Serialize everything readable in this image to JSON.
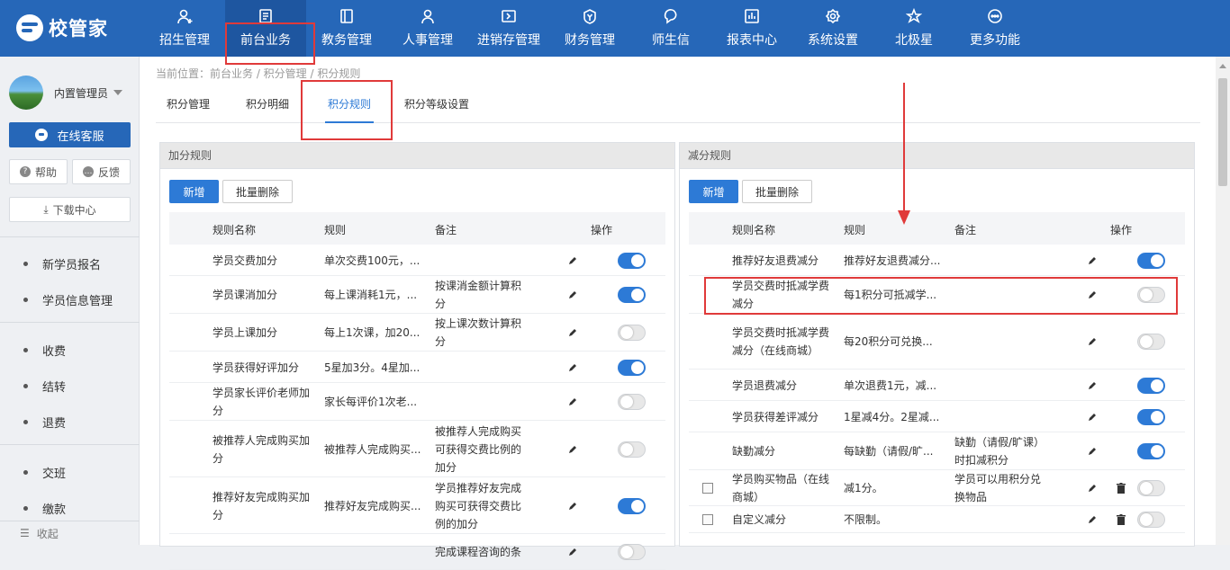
{
  "app": {
    "logo_text": "校管家"
  },
  "nav": [
    {
      "label": "招生管理",
      "icon": "person-add-icon"
    },
    {
      "label": "前台业务",
      "icon": "form-icon"
    },
    {
      "label": "教务管理",
      "icon": "book-icon"
    },
    {
      "label": "人事管理",
      "icon": "person-icon"
    },
    {
      "label": "进销存管理",
      "icon": "inventory-icon"
    },
    {
      "label": "财务管理",
      "icon": "finance-icon"
    },
    {
      "label": "师生信",
      "icon": "chat-bubble-icon"
    },
    {
      "label": "报表中心",
      "icon": "chart-icon"
    },
    {
      "label": "系统设置",
      "icon": "gear-icon"
    },
    {
      "label": "北极星",
      "icon": "star-icon"
    },
    {
      "label": "更多功能",
      "icon": "more-icon"
    }
  ],
  "sidebar": {
    "user_name": "内置管理员",
    "online_service": "在线客服",
    "help": "帮助",
    "feedback": "反馈",
    "download": "下载中心",
    "items": [
      "新学员报名",
      "学员信息管理",
      "收费",
      "结转",
      "退费",
      "交班",
      "缴款"
    ],
    "collapse": "收起"
  },
  "breadcrumb": "当前位置：前台业务 / 积分管理 / 积分规则",
  "tabs": [
    "积分管理",
    "积分明细",
    "积分规则",
    "积分等级设置"
  ],
  "headers": {
    "name": "规则名称",
    "rule": "规则",
    "remark": "备注",
    "action": "操作"
  },
  "buttons": {
    "add": "新增",
    "batch_delete": "批量删除"
  },
  "add_rules": {
    "title": "加分规则",
    "rows": [
      {
        "name": "学员交费加分",
        "rule": "单次交费100元，...",
        "remark": "",
        "enabled": true
      },
      {
        "name": "学员课消加分",
        "rule": "每上课消耗1元，...",
        "remark": "按课消金额计算积分",
        "enabled": true
      },
      {
        "name": "学员上课加分",
        "rule": "每上1次课，加20...",
        "remark": "按上课次数计算积分",
        "enabled": false
      },
      {
        "name": "学员获得好评加分",
        "rule": "5星加3分。4星加...",
        "remark": "",
        "enabled": true
      },
      {
        "name": "学员家长评价老师加分",
        "rule": "家长每评价1次老...",
        "remark": "",
        "enabled": false
      },
      {
        "name": "被推荐人完成购买加分",
        "rule": "被推荐人完成购买...",
        "remark": "被推荐人完成购买可获得交费比例的加分",
        "enabled": false
      },
      {
        "name": "推荐好友完成购买加分",
        "rule": "推荐好友完成购买...",
        "remark": "学员推荐好友完成购买可获得交费比例的加分",
        "enabled": true
      },
      {
        "name": "",
        "rule": "",
        "remark": "完成课程咨询的条",
        "enabled": false
      }
    ]
  },
  "sub_rules": {
    "title": "减分规则",
    "rows": [
      {
        "name": "推荐好友退费减分",
        "rule": "推荐好友退费减分...",
        "remark": "",
        "enabled": true,
        "custom": false
      },
      {
        "name": "学员交费时抵减学费减分",
        "rule": "每1积分可抵减学...",
        "remark": "",
        "enabled": false,
        "custom": false
      },
      {
        "name": "学员交费时抵减学费减分（在线商城）",
        "rule": "每20积分可兑换...",
        "remark": "",
        "enabled": false,
        "custom": false
      },
      {
        "name": "学员退费减分",
        "rule": "单次退费1元，减...",
        "remark": "",
        "enabled": true,
        "custom": false
      },
      {
        "name": "学员获得差评减分",
        "rule": "1星减4分。2星减...",
        "remark": "",
        "enabled": true,
        "custom": false
      },
      {
        "name": "缺勤减分",
        "rule": "每缺勤（请假/旷...",
        "remark": "缺勤（请假/旷课）时扣减积分",
        "enabled": true,
        "custom": false
      },
      {
        "name": "学员购买物品（在线商城）",
        "rule": "减1分。",
        "remark": "学员可以用积分兑换物品",
        "enabled": false,
        "custom": true
      },
      {
        "name": "自定义减分",
        "rule": "不限制。",
        "remark": "",
        "enabled": false,
        "custom": true
      }
    ]
  },
  "colors": {
    "topbar": "#2667b8",
    "accent": "#2d7ad6",
    "highlight_box": "#e03a3a"
  }
}
